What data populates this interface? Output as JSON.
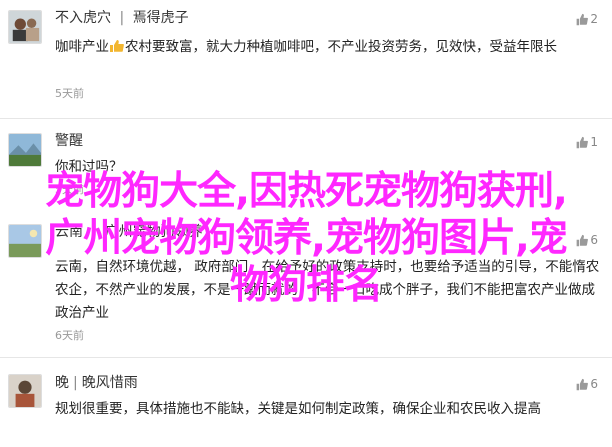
{
  "posts": [
    {
      "username": "不入虎穴",
      "separator": "|",
      "title": "焉得虎子",
      "text_part1": "咖啡产业",
      "text_part2": "农村要致富，就大力种植咖啡吧，不产业投资劳务，见效快，受益年限长",
      "time": "5天前",
      "likes": "2"
    },
    {
      "username": "警醒",
      "text": "你和过吗？",
      "time": "5天前",
      "likes": "1"
    },
    {
      "username": "云南",
      "separator": "|",
      "title": "广州宠物狗领养",
      "text": "云南，自然环境优越，              政府部门，在给予好的政策支持时，也要给予适当的引导，不能惰农农企，不然产业的发展，不是一蹴而就的，不会一口吃成个胖子，我们不能把富农产业做成政治产业",
      "time": "6天前",
      "likes": "6"
    },
    {
      "username": "晚",
      "title": "晚风惜雨",
      "text": "规划很重要，具体措施也不能缺，关键是如何制定政策，确保企业和农民收入提高",
      "likes": "6"
    }
  ],
  "overlay_lines": [
    "宠物狗大全,因热死宠物狗获刑,",
    "广州宠物狗领养,宠物狗图片,宠",
    "物狗排名"
  ],
  "colors": {
    "overlay": "#ff27ff",
    "link": "#3b5998"
  }
}
